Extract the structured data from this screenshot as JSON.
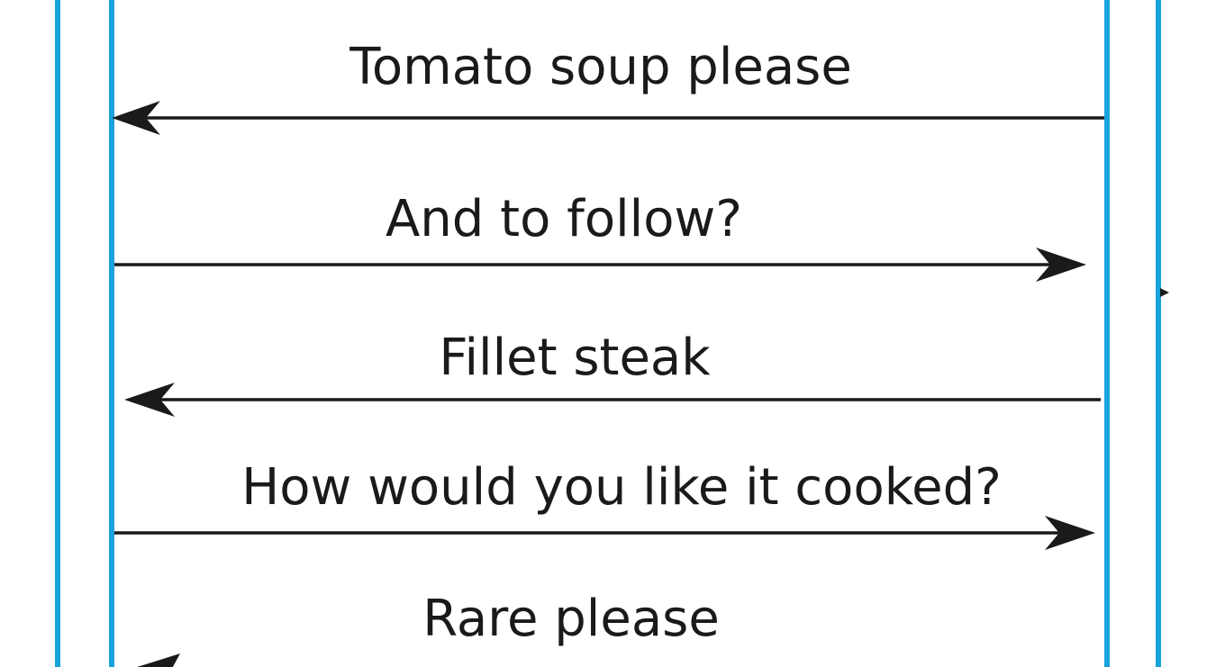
{
  "colors": {
    "lifeline": "#1aa3db",
    "message": "#1a1a1a",
    "background": "#ffffff"
  },
  "messages": [
    {
      "label": "Tomato soup please",
      "direction": "left"
    },
    {
      "label": "And to follow?",
      "direction": "right"
    },
    {
      "label": "Fillet steak",
      "direction": "left"
    },
    {
      "label": "How would you like it cooked?",
      "direction": "right"
    },
    {
      "label": "Rare please",
      "direction": "left"
    }
  ]
}
